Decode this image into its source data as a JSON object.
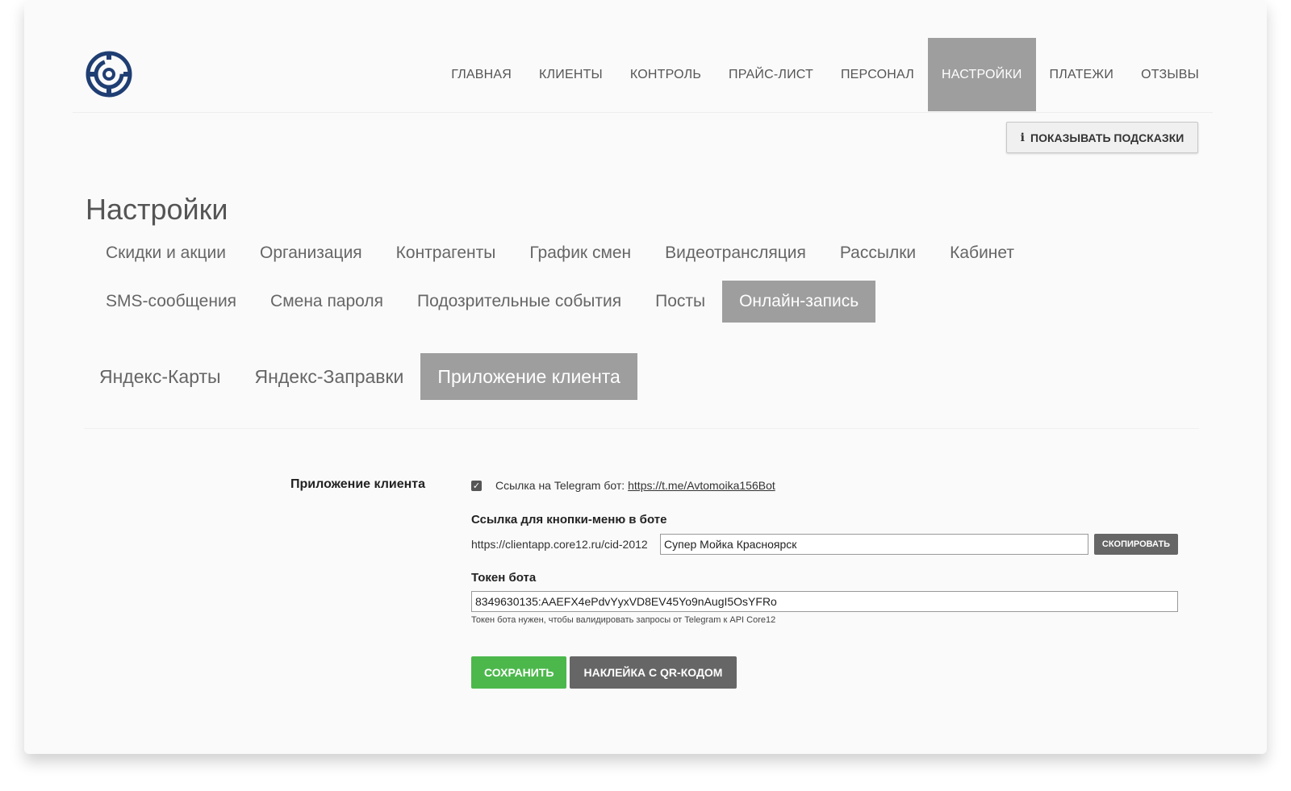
{
  "nav": {
    "items": [
      {
        "label": "ГЛАВНАЯ"
      },
      {
        "label": "КЛИЕНТЫ"
      },
      {
        "label": "КОНТРОЛЬ"
      },
      {
        "label": "ПРАЙС-ЛИСТ"
      },
      {
        "label": "ПЕРСОНАЛ"
      },
      {
        "label": "НАСТРОЙКИ",
        "active": true
      },
      {
        "label": "ПЛАТЕЖИ"
      },
      {
        "label": "ОТЗЫВЫ"
      }
    ]
  },
  "hints_button": {
    "icon": "info-icon",
    "label": "ПОКАЗЫВАТЬ ПОДСКАЗКИ"
  },
  "page_title": "Настройки",
  "settings_tabs": {
    "row1": [
      "Скидки и акции",
      "Организация",
      "Контрагенты",
      "График смен",
      "Видеотрансляция",
      "Рассылки",
      "Кабинет"
    ],
    "row2": [
      "SMS-сообщения",
      "Смена пароля",
      "Подозрительные события",
      "Посты",
      "Онлайн-запись"
    ],
    "row2_active": "Онлайн-запись"
  },
  "sub_tabs": {
    "items": [
      "Яндекс-Карты",
      "Яндекс-Заправки",
      "Приложение клиента"
    ],
    "active": "Приложение клиента"
  },
  "form": {
    "section_label": "Приложение клиента",
    "telegram_checkbox_checked": true,
    "telegram_text": "Ссылка на Telegram бот:",
    "telegram_link": "https://t.me/Avtomoika156Bot",
    "menu_link_label": "Ссылка для кнопки-меню в боте",
    "menu_link_prefix": "https://clientapp.core12.ru/cid-2012",
    "menu_link_value": "Супер Мойка Красноярск",
    "copy_label": "СКОПИРОВАТЬ",
    "token_label": "Токен бота",
    "token_value": "8349630135:AAEFX4ePdvYyxVD8EV45Yo9nAugI5OsYFRo",
    "token_hint": "Токен бота нужен, чтобы валидировать запросы от Telegram к API Core12",
    "save_label": "СОХРАНИТЬ",
    "qr_label": "НАКЛЕЙКА С QR-КОДОМ"
  },
  "colors": {
    "active_tab": "#9e9e9e",
    "save_button": "#4cb84c",
    "dark_button": "#666666",
    "logo": "#1f3e73"
  }
}
